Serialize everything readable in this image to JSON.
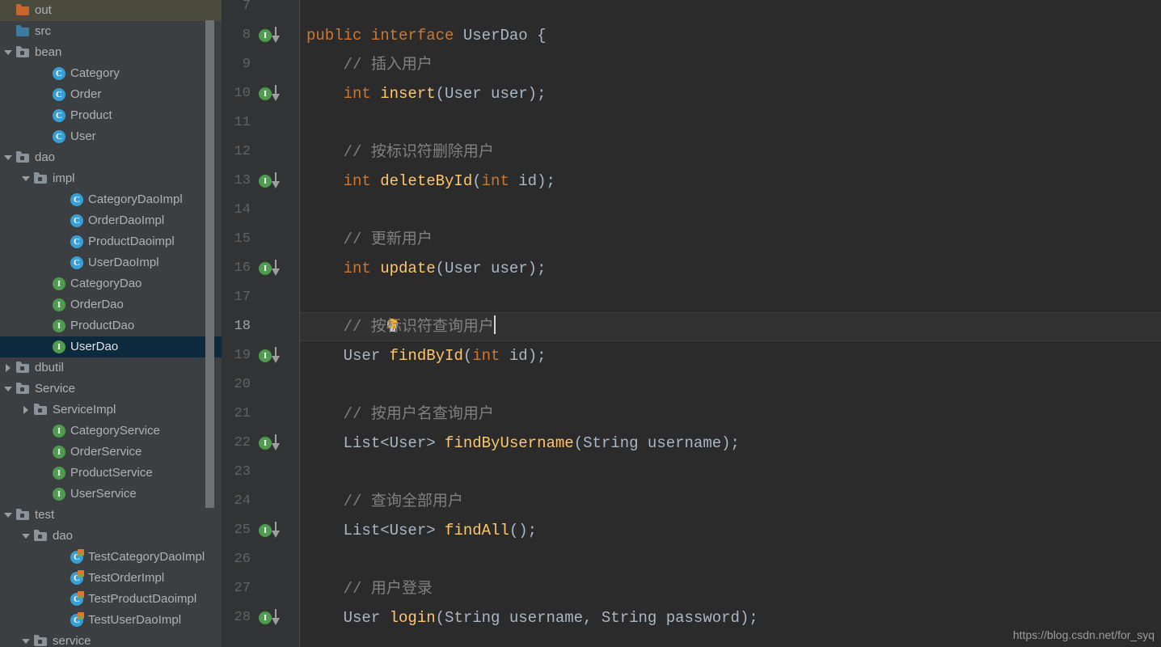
{
  "sidebar": {
    "scrollbar": {
      "name": "project-tree-scrollbar"
    },
    "rows": [
      {
        "label": "out",
        "indent": 0,
        "twisty": "none",
        "icon": "folder-orange",
        "state": "hovered"
      },
      {
        "label": "src",
        "indent": 0,
        "twisty": "none",
        "icon": "folder-blue",
        "state": "normal"
      },
      {
        "label": "bean",
        "indent": 0,
        "twisty": "down",
        "icon": "package",
        "state": "normal"
      },
      {
        "label": "Category",
        "indent": 2,
        "twisty": "none",
        "icon": "class",
        "state": "normal"
      },
      {
        "label": "Order",
        "indent": 2,
        "twisty": "none",
        "icon": "class",
        "state": "normal"
      },
      {
        "label": "Product",
        "indent": 2,
        "twisty": "none",
        "icon": "class",
        "state": "normal"
      },
      {
        "label": "User",
        "indent": 2,
        "twisty": "none",
        "icon": "class",
        "state": "normal"
      },
      {
        "label": "dao",
        "indent": 0,
        "twisty": "down",
        "icon": "package",
        "state": "normal"
      },
      {
        "label": "impl",
        "indent": 1,
        "twisty": "down",
        "icon": "package",
        "state": "normal"
      },
      {
        "label": "CategoryDaoImpl",
        "indent": 3,
        "twisty": "none",
        "icon": "class",
        "state": "normal"
      },
      {
        "label": "OrderDaoImpl",
        "indent": 3,
        "twisty": "none",
        "icon": "class",
        "state": "normal"
      },
      {
        "label": "ProductDaoimpl",
        "indent": 3,
        "twisty": "none",
        "icon": "class",
        "state": "normal"
      },
      {
        "label": "UserDaoImpl",
        "indent": 3,
        "twisty": "none",
        "icon": "class",
        "state": "normal"
      },
      {
        "label": "CategoryDao",
        "indent": 2,
        "twisty": "none",
        "icon": "interface",
        "state": "normal"
      },
      {
        "label": "OrderDao",
        "indent": 2,
        "twisty": "none",
        "icon": "interface",
        "state": "normal"
      },
      {
        "label": "ProductDao",
        "indent": 2,
        "twisty": "none",
        "icon": "interface",
        "state": "normal"
      },
      {
        "label": "UserDao",
        "indent": 2,
        "twisty": "none",
        "icon": "interface",
        "state": "selected"
      },
      {
        "label": "dbutil",
        "indent": 0,
        "twisty": "right",
        "icon": "package",
        "state": "normal"
      },
      {
        "label": "Service",
        "indent": 0,
        "twisty": "down",
        "icon": "package",
        "state": "normal"
      },
      {
        "label": "ServiceImpl",
        "indent": 1,
        "twisty": "right",
        "icon": "package",
        "state": "normal"
      },
      {
        "label": "CategoryService",
        "indent": 2,
        "twisty": "none",
        "icon": "interface",
        "state": "normal"
      },
      {
        "label": "OrderService",
        "indent": 2,
        "twisty": "none",
        "icon": "interface",
        "state": "normal"
      },
      {
        "label": "ProductService",
        "indent": 2,
        "twisty": "none",
        "icon": "interface",
        "state": "normal"
      },
      {
        "label": "UserService",
        "indent": 2,
        "twisty": "none",
        "icon": "interface",
        "state": "normal"
      },
      {
        "label": "test",
        "indent": 0,
        "twisty": "down",
        "icon": "package",
        "state": "normal"
      },
      {
        "label": "dao",
        "indent": 1,
        "twisty": "down",
        "icon": "package",
        "state": "normal"
      },
      {
        "label": "TestCategoryDaoImpl",
        "indent": 3,
        "twisty": "none",
        "icon": "test-class",
        "state": "normal"
      },
      {
        "label": "TestOrderImpl",
        "indent": 3,
        "twisty": "none",
        "icon": "test-class",
        "state": "normal"
      },
      {
        "label": "TestProductDaoimpl",
        "indent": 3,
        "twisty": "none",
        "icon": "test-class",
        "state": "normal"
      },
      {
        "label": "TestUserDaoImpl",
        "indent": 3,
        "twisty": "none",
        "icon": "test-class",
        "state": "normal"
      },
      {
        "label": "service",
        "indent": 1,
        "twisty": "down",
        "icon": "package",
        "state": "normal"
      }
    ]
  },
  "editor": {
    "first_line_number": 7,
    "current_line_number": 18,
    "lines": [
      {
        "n": 7,
        "gutter": "none",
        "tokens": []
      },
      {
        "n": 8,
        "gutter": "implemented",
        "tokens": [
          {
            "t": "public ",
            "c": "kw"
          },
          {
            "t": "interface ",
            "c": "kw"
          },
          {
            "t": "UserDao",
            "c": "cls-n"
          },
          {
            "t": " {",
            "c": "pun"
          }
        ]
      },
      {
        "n": 9,
        "gutter": "none",
        "tokens": [
          {
            "t": "    // 插入用户",
            "c": "cmt"
          }
        ]
      },
      {
        "n": 10,
        "gutter": "implemented",
        "tokens": [
          {
            "t": "    ",
            "c": "pun"
          },
          {
            "t": "int ",
            "c": "kw"
          },
          {
            "t": "insert",
            "c": "mth"
          },
          {
            "t": "(",
            "c": "pun"
          },
          {
            "t": "User",
            "c": "cls-n"
          },
          {
            "t": " user",
            "c": "pun"
          },
          {
            "t": ");",
            "c": "pun"
          }
        ]
      },
      {
        "n": 11,
        "gutter": "none",
        "tokens": []
      },
      {
        "n": 12,
        "gutter": "none",
        "tokens": [
          {
            "t": "    // 按标识符删除用户",
            "c": "cmt"
          }
        ]
      },
      {
        "n": 13,
        "gutter": "implemented",
        "tokens": [
          {
            "t": "    ",
            "c": "pun"
          },
          {
            "t": "int ",
            "c": "kw"
          },
          {
            "t": "deleteById",
            "c": "mth"
          },
          {
            "t": "(",
            "c": "pun"
          },
          {
            "t": "int",
            "c": "kw"
          },
          {
            "t": " id",
            "c": "pun"
          },
          {
            "t": ");",
            "c": "pun"
          }
        ]
      },
      {
        "n": 14,
        "gutter": "none",
        "tokens": []
      },
      {
        "n": 15,
        "gutter": "none",
        "tokens": [
          {
            "t": "    // 更新用户",
            "c": "cmt"
          }
        ]
      },
      {
        "n": 16,
        "gutter": "implemented",
        "tokens": [
          {
            "t": "    ",
            "c": "pun"
          },
          {
            "t": "int ",
            "c": "kw"
          },
          {
            "t": "update",
            "c": "mth"
          },
          {
            "t": "(",
            "c": "pun"
          },
          {
            "t": "User",
            "c": "cls-n"
          },
          {
            "t": " user",
            "c": "pun"
          },
          {
            "t": ");",
            "c": "pun"
          }
        ]
      },
      {
        "n": 17,
        "gutter": "none",
        "tokens": []
      },
      {
        "n": 18,
        "gutter": "bulb",
        "current": true,
        "caret": true,
        "tokens": [
          {
            "t": "    // 按标识符查询用户",
            "c": "cmt"
          }
        ]
      },
      {
        "n": 19,
        "gutter": "implemented",
        "tokens": [
          {
            "t": "    ",
            "c": "pun"
          },
          {
            "t": "User",
            "c": "cls-n"
          },
          {
            "t": " ",
            "c": "pun"
          },
          {
            "t": "findById",
            "c": "mth"
          },
          {
            "t": "(",
            "c": "pun"
          },
          {
            "t": "int",
            "c": "kw"
          },
          {
            "t": " id",
            "c": "pun"
          },
          {
            "t": ");",
            "c": "pun"
          }
        ]
      },
      {
        "n": 20,
        "gutter": "none",
        "tokens": []
      },
      {
        "n": 21,
        "gutter": "none",
        "tokens": [
          {
            "t": "    // 按用户名查询用户",
            "c": "cmt"
          }
        ]
      },
      {
        "n": 22,
        "gutter": "implemented",
        "tokens": [
          {
            "t": "    ",
            "c": "pun"
          },
          {
            "t": "List<User>",
            "c": "cls-n"
          },
          {
            "t": " ",
            "c": "pun"
          },
          {
            "t": "findByUsername",
            "c": "mth"
          },
          {
            "t": "(",
            "c": "pun"
          },
          {
            "t": "String",
            "c": "cls-n"
          },
          {
            "t": " username",
            "c": "pun"
          },
          {
            "t": ");",
            "c": "pun"
          }
        ]
      },
      {
        "n": 23,
        "gutter": "none",
        "tokens": []
      },
      {
        "n": 24,
        "gutter": "none",
        "tokens": [
          {
            "t": "    // 查询全部用户",
            "c": "cmt"
          }
        ]
      },
      {
        "n": 25,
        "gutter": "implemented",
        "tokens": [
          {
            "t": "    ",
            "c": "pun"
          },
          {
            "t": "List<User>",
            "c": "cls-n"
          },
          {
            "t": " ",
            "c": "pun"
          },
          {
            "t": "findAll",
            "c": "mth"
          },
          {
            "t": "();",
            "c": "pun"
          }
        ]
      },
      {
        "n": 26,
        "gutter": "none",
        "tokens": []
      },
      {
        "n": 27,
        "gutter": "none",
        "tokens": [
          {
            "t": "    // 用户登录",
            "c": "cmt"
          }
        ]
      },
      {
        "n": 28,
        "gutter": "implemented",
        "tokens": [
          {
            "t": "    ",
            "c": "pun"
          },
          {
            "t": "User",
            "c": "cls-n"
          },
          {
            "t": " ",
            "c": "pun"
          },
          {
            "t": "login",
            "c": "mth"
          },
          {
            "t": "(",
            "c": "pun"
          },
          {
            "t": "String",
            "c": "cls-n"
          },
          {
            "t": " username, ",
            "c": "pun"
          },
          {
            "t": "String",
            "c": "cls-n"
          },
          {
            "t": " password",
            "c": "pun"
          },
          {
            "t": ");",
            "c": "pun"
          }
        ]
      }
    ],
    "gutter_icon_label": "I"
  },
  "watermark": {
    "text": "https://blog.csdn.net/for_syq"
  },
  "colors": {
    "sidebar_bg": "#3c3f41",
    "editor_bg": "#2b2b2b",
    "gutter_bg": "#313335",
    "selection_bg": "#0d293e",
    "hover_bg": "#4b4b3d",
    "keyword": "#cc7832",
    "method": "#ffc66d",
    "comment": "#808080",
    "identifier": "#a9b7c6",
    "interface_icon": "#4f9b4f",
    "class_icon": "#389fd6",
    "folder_orange": "#c5662f",
    "folder_blue": "#3f7ba0"
  }
}
